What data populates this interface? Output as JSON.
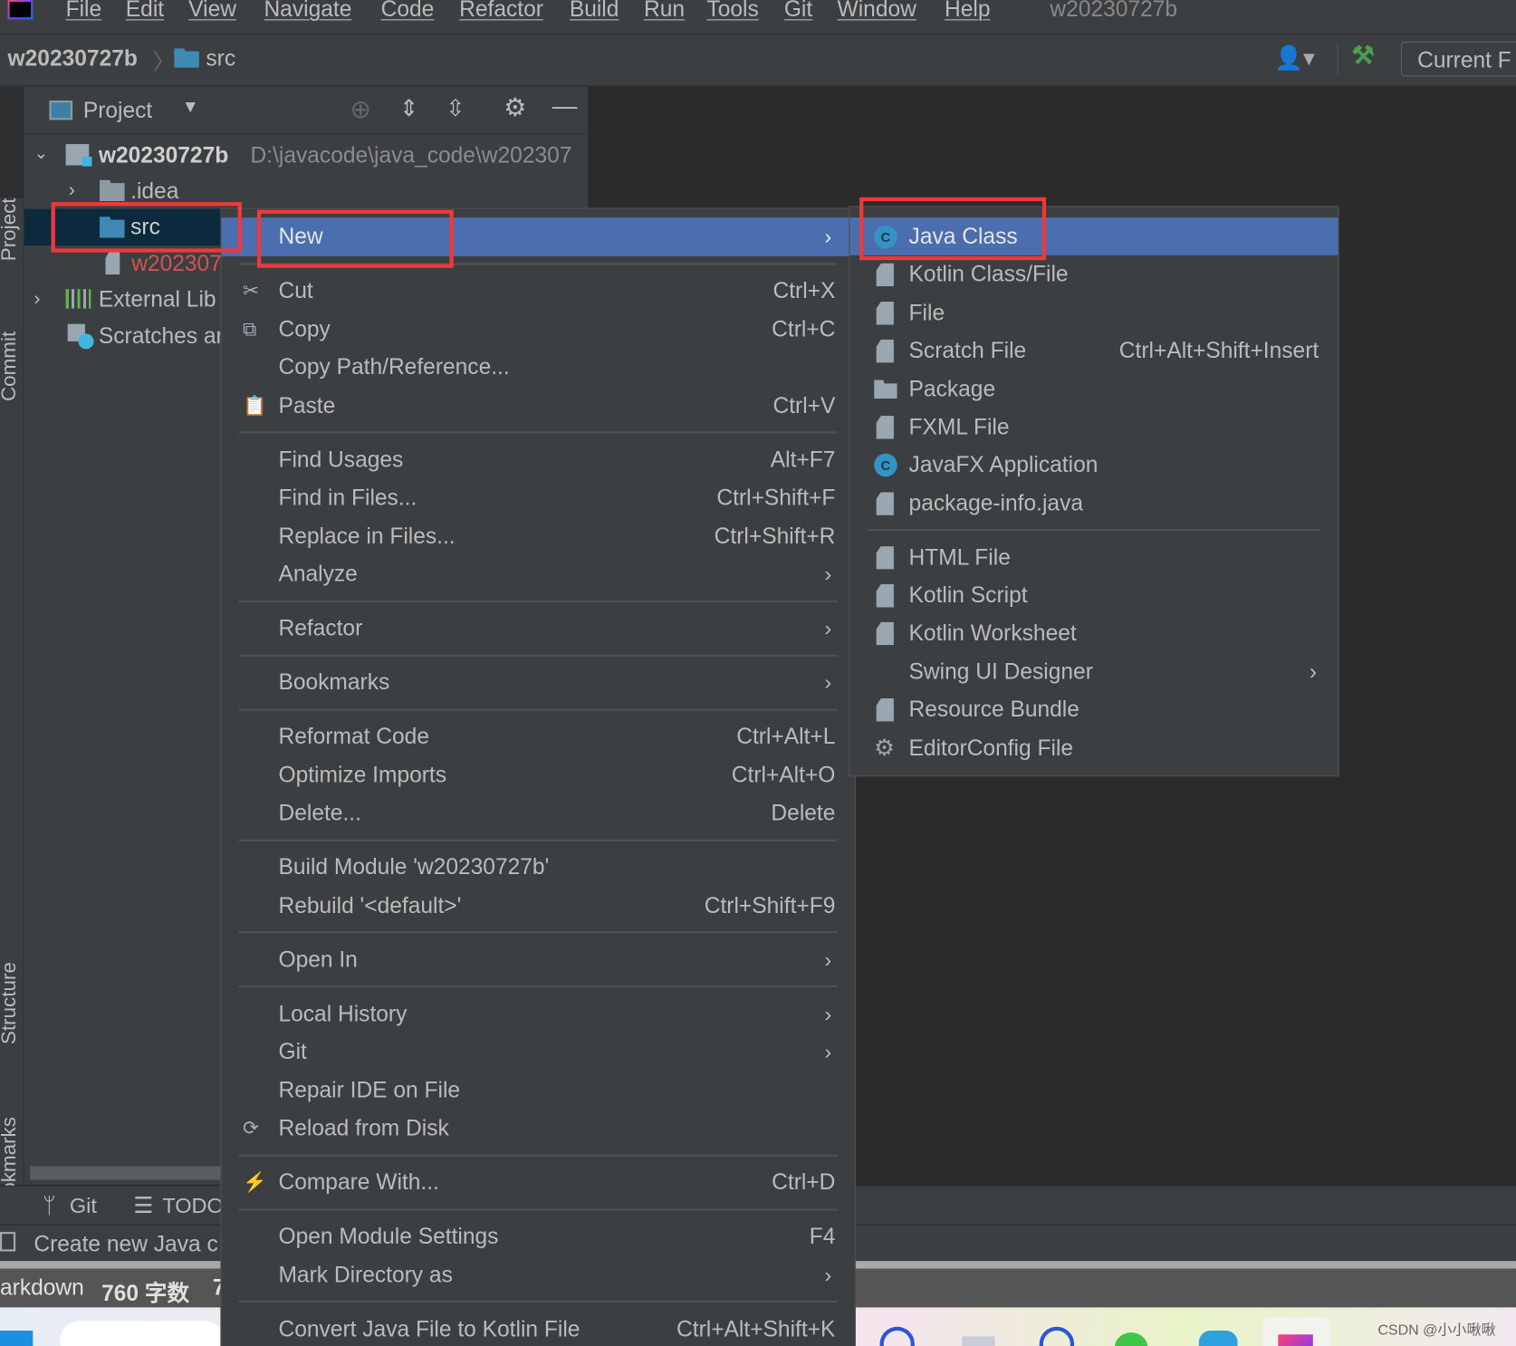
{
  "menubar": {
    "items": [
      "File",
      "Edit",
      "View",
      "Navigate",
      "Code",
      "Refactor",
      "Build",
      "Run",
      "Tools",
      "Git",
      "Window",
      "Help"
    ],
    "title": "w20230727b"
  },
  "navbar": {
    "breadcrumb": [
      "w20230727b",
      "src"
    ],
    "run_config": "Current F"
  },
  "stripe": {
    "labels": [
      "Project",
      "Commit",
      "Structure",
      "Bookmarks"
    ]
  },
  "project": {
    "title": "Project",
    "tree": [
      {
        "label": "w20230727b",
        "path": "D:\\javacode\\java_code\\w202307"
      },
      {
        "label": ".idea"
      },
      {
        "label": "src"
      },
      {
        "label": "w202307"
      },
      {
        "label": "External Lib"
      },
      {
        "label": "Scratches ar"
      }
    ]
  },
  "bottom": {
    "git": "Git",
    "todo": "TODO",
    "status": "Create new Java c",
    "markdown": "arkdown",
    "words_count": "760 字数",
    "extra": "7",
    "watermark": "CSDN @小小啾啾"
  },
  "context_menu": {
    "items": [
      {
        "label": "New",
        "submenu": true
      },
      {
        "sep": true
      },
      {
        "label": "Cut",
        "shortcut": "Ctrl+X",
        "icon": "scissors"
      },
      {
        "label": "Copy",
        "shortcut": "Ctrl+C",
        "icon": "copy"
      },
      {
        "label": "Copy Path/Reference..."
      },
      {
        "label": "Paste",
        "shortcut": "Ctrl+V",
        "icon": "clipboard"
      },
      {
        "sep": true
      },
      {
        "label": "Find Usages",
        "shortcut": "Alt+F7"
      },
      {
        "label": "Find in Files...",
        "shortcut": "Ctrl+Shift+F"
      },
      {
        "label": "Replace in Files...",
        "shortcut": "Ctrl+Shift+R"
      },
      {
        "label": "Analyze",
        "submenu": true
      },
      {
        "sep": true
      },
      {
        "label": "Refactor",
        "submenu": true
      },
      {
        "sep": true
      },
      {
        "label": "Bookmarks",
        "submenu": true
      },
      {
        "sep": true
      },
      {
        "label": "Reformat Code",
        "shortcut": "Ctrl+Alt+L"
      },
      {
        "label": "Optimize Imports",
        "shortcut": "Ctrl+Alt+O"
      },
      {
        "label": "Delete...",
        "shortcut": "Delete"
      },
      {
        "sep": true
      },
      {
        "label": "Build Module 'w20230727b'"
      },
      {
        "label": "Rebuild '<default>'",
        "shortcut": "Ctrl+Shift+F9"
      },
      {
        "sep": true
      },
      {
        "label": "Open In",
        "submenu": true
      },
      {
        "sep": true
      },
      {
        "label": "Local History",
        "submenu": true
      },
      {
        "label": "Git",
        "submenu": true
      },
      {
        "label": "Repair IDE on File"
      },
      {
        "label": "Reload from Disk",
        "icon": "reload"
      },
      {
        "sep": true
      },
      {
        "label": "Compare With...",
        "shortcut": "Ctrl+D",
        "icon": "compare"
      },
      {
        "sep": true
      },
      {
        "label": "Open Module Settings",
        "shortcut": "F4"
      },
      {
        "label": "Mark Directory as",
        "submenu": true
      },
      {
        "sep": true
      },
      {
        "label": "Convert Java File to Kotlin File",
        "shortcut": "Ctrl+Alt+Shift+K"
      }
    ]
  },
  "new_submenu": {
    "items": [
      {
        "label": "Java Class",
        "icon": "java-class"
      },
      {
        "label": "Kotlin Class/File",
        "icon": "kotlin-file"
      },
      {
        "label": "File",
        "icon": "file"
      },
      {
        "label": "Scratch File",
        "shortcut": "Ctrl+Alt+Shift+Insert",
        "icon": "scratch-file"
      },
      {
        "label": "Package",
        "icon": "package"
      },
      {
        "label": "FXML File",
        "icon": "fxml-file"
      },
      {
        "label": "JavaFX Application",
        "icon": "javafx"
      },
      {
        "label": "package-info.java",
        "icon": "java-file"
      },
      {
        "sep": true
      },
      {
        "label": "HTML File",
        "icon": "html-file"
      },
      {
        "label": "Kotlin Script",
        "icon": "kotlin-script"
      },
      {
        "label": "Kotlin Worksheet",
        "icon": "kotlin-worksheet"
      },
      {
        "label": "Swing UI Designer",
        "submenu": true
      },
      {
        "label": "Resource Bundle",
        "icon": "resource-bundle"
      },
      {
        "label": "EditorConfig File",
        "icon": "gear"
      }
    ]
  },
  "colors": {
    "highlight": "#4b6eaf",
    "annotation": "#f0383a",
    "panel": "#3c3f41",
    "editor": "#2b2b2b"
  }
}
